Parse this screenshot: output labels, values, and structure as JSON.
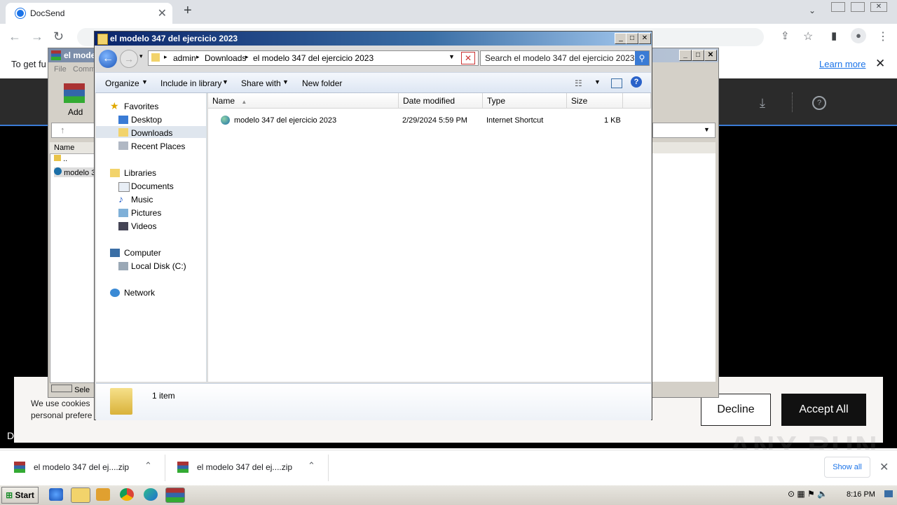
{
  "browser": {
    "tab_title": "DocSend",
    "banner_text": "To get fu",
    "banner_link": "Learn more"
  },
  "page": {
    "cookie_text_line1": "We use cookies",
    "cookie_text_line2": "personal prefere",
    "decline_label": "Decline",
    "accept_label": "Accept All",
    "partial_text": "D",
    "watermark": "ANY RUN"
  },
  "downloads": {
    "items": [
      {
        "name": "el modelo 347 del ej....zip"
      },
      {
        "name": "el modelo 347 del ej....zip"
      }
    ],
    "show_all": "Show all"
  },
  "winrar": {
    "title": "el mode",
    "menu_file": "File",
    "menu_commands": "Comm",
    "add_label": "Add",
    "col_name": "Name",
    "row_up": "..",
    "row_file": "modelo 3",
    "status": "Sele"
  },
  "explorer": {
    "title": "el modelo 347 del ejercicio 2023",
    "breadcrumb": [
      "admin",
      "Downloads",
      "el modelo 347 del ejercicio 2023"
    ],
    "search_placeholder": "Search el modelo 347 del ejercicio 2023",
    "commands": {
      "organize": "Organize",
      "include": "Include in library",
      "share": "Share with",
      "new_folder": "New folder"
    },
    "nav": {
      "favorites": "Favorites",
      "desktop": "Desktop",
      "downloads": "Downloads",
      "recent": "Recent Places",
      "libraries": "Libraries",
      "documents": "Documents",
      "music": "Music",
      "pictures": "Pictures",
      "videos": "Videos",
      "computer": "Computer",
      "local_disk": "Local Disk (C:)",
      "network": "Network"
    },
    "columns": {
      "name": "Name",
      "date": "Date modified",
      "type": "Type",
      "size": "Size"
    },
    "files": [
      {
        "name": "modelo 347 del ejercicio 2023",
        "date": "2/29/2024 5:59 PM",
        "type": "Internet Shortcut",
        "size": "1 KB"
      }
    ],
    "item_count": "1 item"
  },
  "taskbar": {
    "start": "Start",
    "clock": "8:16 PM"
  }
}
